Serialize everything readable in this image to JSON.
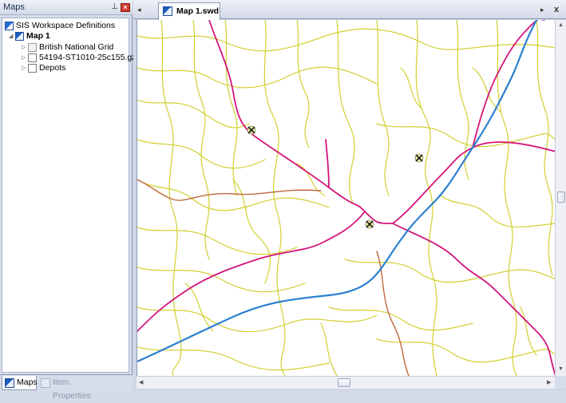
{
  "left_panel": {
    "title": "Maps",
    "pin_icon": "pin-icon",
    "close_icon": "close-icon",
    "tree": {
      "root_label": "SIS Workspace Definitions",
      "map_label": "Map 1",
      "children": [
        {
          "label": "British National Grid",
          "icon": "grid-icon"
        },
        {
          "label": "54194-ST1010-25c155.gz",
          "icon": "document-icon"
        },
        {
          "label": "Depots",
          "icon": "document-icon"
        }
      ]
    },
    "bottom_tabs": [
      {
        "label": "Maps",
        "active": true
      },
      {
        "label": "Item Properties",
        "active": false
      }
    ]
  },
  "document": {
    "tab_label": "Map 1.swd",
    "nav_left": "◂",
    "nav_right": "▸",
    "close": "x"
  },
  "map": {
    "colors": {
      "minor_roads": "#d3cf30",
      "major_roads": "#d3147a",
      "railway": "#2c80d0",
      "secondary_roads": "#c06a3c",
      "depot_symbol": "#1a1a1a"
    },
    "depot_markers": 3
  },
  "scrollbars": {
    "up": "▲",
    "down": "▼",
    "left": "◀",
    "right": "▶"
  }
}
